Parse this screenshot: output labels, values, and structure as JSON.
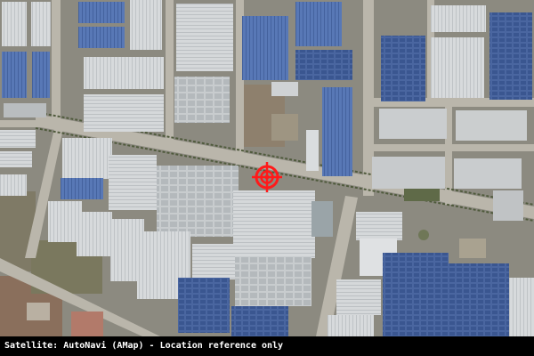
{
  "caption": "Satellite: AutoNavi (AMap) - Location reference only",
  "marker": {
    "icon": "crosshair-target-icon",
    "color": "#ff1a1a"
  },
  "colors": {
    "ground": "#8d8a80",
    "road": "#b9b5aa",
    "roof_blue": "#4f6fae",
    "roof_grey": "#c9cdd0",
    "roof_white": "#e6e8ea",
    "roof_solar": "#3e5a8c",
    "vegetation": "#6d7458"
  }
}
